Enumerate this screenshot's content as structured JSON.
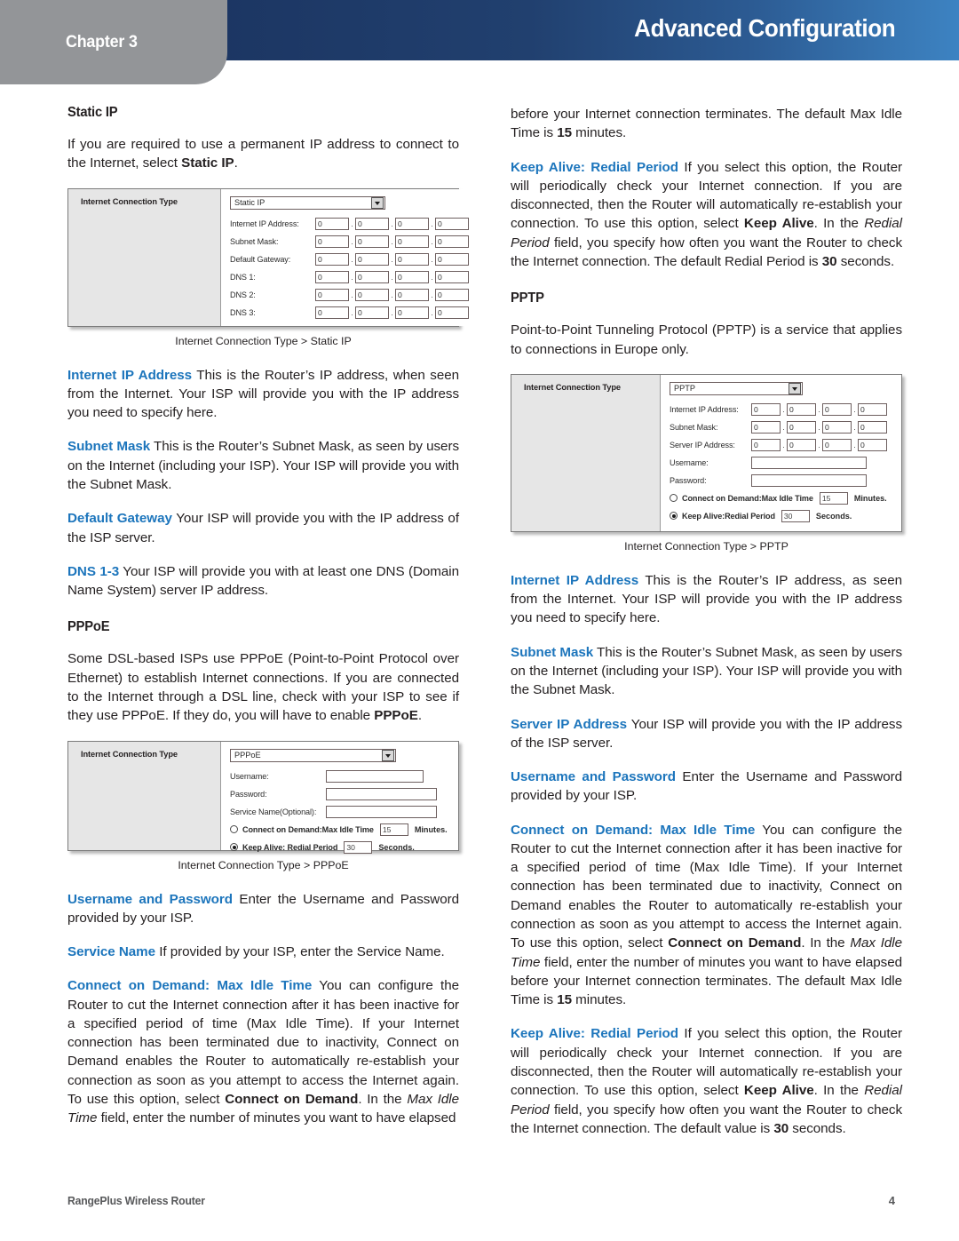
{
  "header": {
    "chapter_label": "Chapter 3",
    "title": "Advanced Configuration",
    "band_color_left": "#1c3663",
    "band_color_right": "#3d83c2",
    "tab_color": "#939598"
  },
  "accent_color": "#1c75bc",
  "left_column": {
    "heading_static_ip": "Static IP",
    "intro_static_ip_pre": "If you are required to use a permanent IP address to connect to the Internet, select ",
    "intro_static_ip_bold": "Static IP",
    "intro_static_ip_post": ".",
    "figure_static_ip": {
      "panel_title": "Internet Connection Type",
      "dropdown_value": "Static IP",
      "fields": [
        {
          "label": "Internet IP Address:",
          "octets": [
            "0",
            "0",
            "0",
            "0"
          ]
        },
        {
          "label": "Subnet Mask:",
          "octets": [
            "0",
            "0",
            "0",
            "0"
          ]
        },
        {
          "label": "Default Gateway:",
          "octets": [
            "0",
            "0",
            "0",
            "0"
          ]
        },
        {
          "label": "DNS 1:",
          "octets": [
            "0",
            "0",
            "0",
            "0"
          ]
        },
        {
          "label": "DNS 2:",
          "octets": [
            "0",
            "0",
            "0",
            "0"
          ]
        },
        {
          "label": "DNS 3:",
          "octets": [
            "0",
            "0",
            "0",
            "0"
          ]
        }
      ],
      "caption": "Internet Connection Type > Static IP"
    },
    "para_internet_ip_lead": "Internet IP Address",
    "para_internet_ip_body": "  This is the Router’s IP address, when seen from the Internet. Your ISP will provide you with the IP address you need to specify here.",
    "para_subnet_lead": "Subnet Mask",
    "para_subnet_body": "  This is the Router’s Subnet Mask, as seen by users on the Internet (including your ISP). Your ISP will provide you with the Subnet Mask.",
    "para_gateway_lead": "Default Gateway",
    "para_gateway_body": "  Your ISP will provide you with the IP address of the ISP server.",
    "para_dns_lead": "DNS 1-3",
    "para_dns_body": "  Your ISP will provide you with at least one DNS (Domain Name System) server IP address.",
    "heading_pppoe": "PPPoE",
    "intro_pppoe_pre": "Some DSL-based ISPs use PPPoE (Point-to-Point Protocol over Ethernet) to establish Internet connections. If you are connected to the Internet through a DSL line, check with your ISP to see if they use PPPoE. If they do, you will have to enable ",
    "intro_pppoe_bold": "PPPoE",
    "intro_pppoe_post": ".",
    "figure_pppoe": {
      "panel_title": "Internet Connection Type",
      "dropdown_value": "PPPoE",
      "text_fields": [
        {
          "label": "Username:"
        },
        {
          "label": "Password:"
        },
        {
          "label": "Service Name(Optional):"
        }
      ],
      "option_connect_on_demand": {
        "selected": false,
        "label": "Connect on Demand:Max Idle Time",
        "value": "15",
        "unit": "Minutes."
      },
      "option_keep_alive": {
        "selected": true,
        "label": "Keep Alive: Redial Period",
        "value": "30",
        "unit": "Seconds."
      },
      "caption": "Internet Connection Type > PPPoE"
    },
    "para_userpass_lead": "Username and Password",
    "para_userpass_body": " Enter the Username and Password provided by your ISP.",
    "para_servicename_lead": "Service Name",
    "para_servicename_body": "  If provided by your ISP, enter the Service Name.",
    "para_cod_lead": "Connect on Demand: Max Idle Time",
    "para_cod_body_1": "  You can configure the Router to cut the Internet connection after it has been inactive for a specified period of time (Max Idle Time). If your Internet connection has been terminated due to inactivity, Connect on Demand enables the Router to automatically re-establish your connection as soon as you attempt to access the Internet again. To use this option, select ",
    "para_cod_bold_1": "Connect on Demand",
    "para_cod_body_2": ". In the ",
    "para_cod_italic_1": "Max Idle Time",
    "para_cod_body_3": " field, enter the number of minutes you want to have elapsed"
  },
  "right_column": {
    "para_cont_1": "before your Internet connection terminates. The default Max Idle Time is ",
    "para_cont_1_bold": "15",
    "para_cont_1_post": " minutes.",
    "para_keepalive_lead": "Keep Alive: Redial Period",
    "para_keepalive_body_1": " If you select this option, the Router will periodically check your Internet connection. If you are disconnected, then the Router will automatically re-establish your connection. To use this option, select ",
    "para_keepalive_bold_1": "Keep Alive",
    "para_keepalive_body_2": ". In the ",
    "para_keepalive_italic_1": "Redial Period",
    "para_keepalive_body_3": " field, you specify how often you want the Router to check the Internet connection. The default Redial Period is ",
    "para_keepalive_bold_2": "30",
    "para_keepalive_body_4": " seconds.",
    "heading_pptp": "PPTP",
    "intro_pptp": "Point-to-Point Tunneling Protocol (PPTP) is a service that applies to connections in Europe only.",
    "figure_pptp": {
      "panel_title": "Internet Connection Type",
      "dropdown_value": "PPTP",
      "ip_fields": [
        {
          "label": "Internet IP Address:",
          "octets": [
            "0",
            "0",
            "0",
            "0"
          ]
        },
        {
          "label": "Subnet Mask:",
          "octets": [
            "0",
            "0",
            "0",
            "0"
          ]
        },
        {
          "label": "Server IP Address:",
          "octets": [
            "0",
            "0",
            "0",
            "0"
          ]
        }
      ],
      "text_fields": [
        {
          "label": "Username:"
        },
        {
          "label": "Password:"
        }
      ],
      "option_connect_on_demand": {
        "selected": false,
        "label": "Connect on Demand:Max Idle Time",
        "value": "15",
        "unit": "Minutes."
      },
      "option_keep_alive": {
        "selected": true,
        "label": "Keep Alive:Redial Period",
        "value": "30",
        "unit": "Seconds."
      },
      "caption": "Internet Connection Type > PPTP"
    },
    "para_internet_ip_lead": "Internet IP Address",
    "para_internet_ip_body": "  This is the Router’s IP address, as seen from the Internet. Your ISP will provide you with the IP address you need to specify here.",
    "para_subnet_lead": "Subnet Mask",
    "para_subnet_body": "  This is the Router’s Subnet Mask, as seen by users on the Internet (including your ISP). Your ISP will provide you with the Subnet Mask.",
    "para_server_ip_lead": "Server IP Address",
    "para_server_ip_body": "  Your ISP will provide you with the IP address of the ISP server.",
    "para_userpass_lead": "Username and Password",
    "para_userpass_body": " Enter the Username and Password provided by your ISP.",
    "para_cod_lead": "Connect on Demand: Max Idle Time",
    "para_cod_body_1": "  You can configure the Router to cut the Internet connection after it has been inactive for a specified period of time (Max Idle Time). If your Internet connection has been terminated due to inactivity, Connect on Demand enables the Router to automatically re-establish your connection as soon as you attempt to access the Internet again. To use this option, select ",
    "para_cod_bold_1": "Connect on Demand",
    "para_cod_body_2": ". In the ",
    "para_cod_italic_1": "Max Idle Time",
    "para_cod_body_3": " field, enter the number of minutes you want to have elapsed before your Internet connection terminates. The default Max Idle Time is ",
    "para_cod_bold_2": "15",
    "para_cod_body_4": " minutes.",
    "para_keepalive2_lead": "Keep Alive: Redial Period",
    "para_keepalive2_body_1": "  If you select this option, the Router will periodically check your Internet connection. If you are disconnected, then the Router will automatically re-establish your connection. To use this option, select ",
    "para_keepalive2_bold_1": "Keep Alive",
    "para_keepalive2_body_2": ". In the ",
    "para_keepalive2_italic_1": "Redial Period",
    "para_keepalive2_body_3": " field, you specify how often you want the Router to check the Internet connection. The default value is ",
    "para_keepalive2_bold_2": "30",
    "para_keepalive2_body_4": " seconds."
  },
  "footer": {
    "product": "RangePlus Wireless Router",
    "page_number": "4"
  }
}
